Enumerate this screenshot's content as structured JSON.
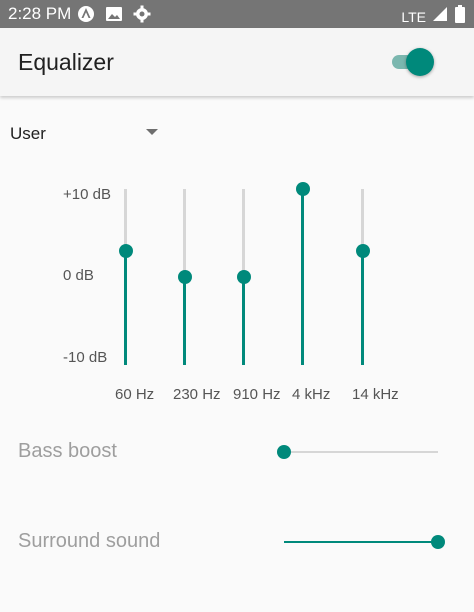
{
  "status_bar": {
    "time": "2:28 PM",
    "network": "LTE",
    "icons": [
      "android-notification-icon",
      "image-icon",
      "gear-icon",
      "signal-icon",
      "battery-icon"
    ]
  },
  "app_bar": {
    "title": "Equalizer",
    "enabled": true
  },
  "preset": {
    "selected": "User"
  },
  "equalizer": {
    "scale": {
      "max_label": "+10 dB",
      "mid_label": "0 dB",
      "min_label": "-10 dB",
      "max": 10,
      "min": -10
    },
    "bands": [
      {
        "label": "60 Hz",
        "db": 3
      },
      {
        "label": "230 Hz",
        "db": 0
      },
      {
        "label": "910 Hz",
        "db": 0
      },
      {
        "label": "4 kHz",
        "db": 10
      },
      {
        "label": "14 kHz",
        "db": 3
      }
    ]
  },
  "bass_boost": {
    "label": "Bass boost",
    "level": 0
  },
  "surround_sound": {
    "label": "Surround sound",
    "level": 1
  },
  "colors": {
    "accent": "#00897b",
    "accent_light": "#7bb7af",
    "status_bar": "#757575"
  }
}
